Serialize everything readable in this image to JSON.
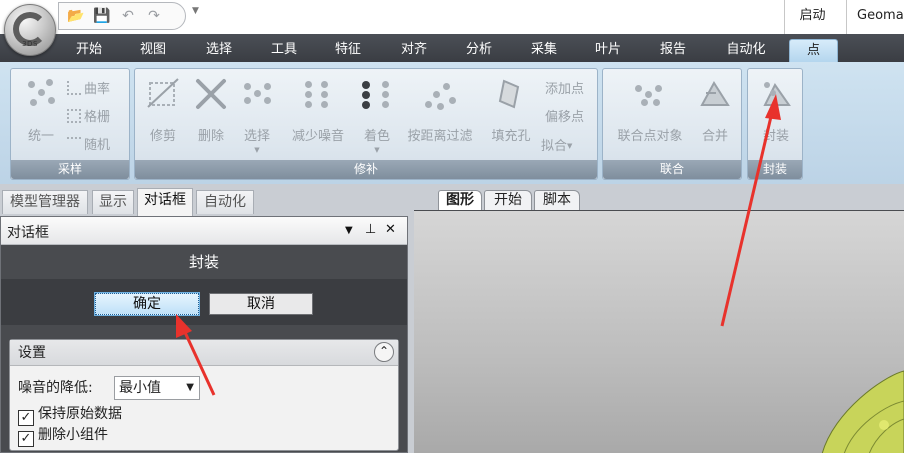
{
  "titlebar": {
    "logo_text": "3DS",
    "launch_label": "启动",
    "app_name": "Geoma"
  },
  "ribbon_tabs": [
    {
      "label": "开始"
    },
    {
      "label": "视图"
    },
    {
      "label": "选择"
    },
    {
      "label": "工具"
    },
    {
      "label": "特征"
    },
    {
      "label": "对齐"
    },
    {
      "label": "分析"
    },
    {
      "label": "采集"
    },
    {
      "label": "叶片"
    },
    {
      "label": "报告"
    },
    {
      "label": "自动化"
    },
    {
      "label": "点"
    }
  ],
  "active_ribbon_tab": "点",
  "ribbon": {
    "sampling": {
      "label": "采样",
      "uniform": "统一",
      "curvature": "曲率",
      "grid": "格栅",
      "random": "随机"
    },
    "repair": {
      "label": "修补",
      "trim": "修剪",
      "delete": "删除",
      "select": "选择",
      "reduce_noise": "减少噪音",
      "color": "着色",
      "distance_filter": "按距离过滤",
      "fill_hole": "填充孔",
      "add_point": "添加点",
      "offset_point": "偏移点",
      "fit": "拟合"
    },
    "combine": {
      "label": "联合",
      "combine_objects": "联合点对象",
      "merge": "合并"
    },
    "wrap": {
      "label": "封装",
      "wrap": "封装"
    }
  },
  "panel_tabs": [
    {
      "label": "模型管理器"
    },
    {
      "label": "显示"
    },
    {
      "label": "对话框"
    },
    {
      "label": "自动化"
    }
  ],
  "panel": {
    "title": "对话框",
    "dialog_title": "封装",
    "ok_label": "确定",
    "cancel_label": "取消",
    "settings": {
      "header": "设置",
      "noise_label": "噪音的降低:",
      "noise_value": "最小值",
      "keep_original_label": "保持原始数据",
      "keep_original_checked": true,
      "remove_small_label": "删除小组件",
      "remove_small_checked": true
    }
  },
  "viewport_tabs": [
    {
      "label": "图形"
    },
    {
      "label": "开始"
    },
    {
      "label": "脚本"
    }
  ],
  "colors": {
    "tabbar": "#3f4248",
    "active_tab": "#cfe6f7",
    "annotation_arrow": "#e8322c",
    "model_yellow": "#d7e061"
  }
}
